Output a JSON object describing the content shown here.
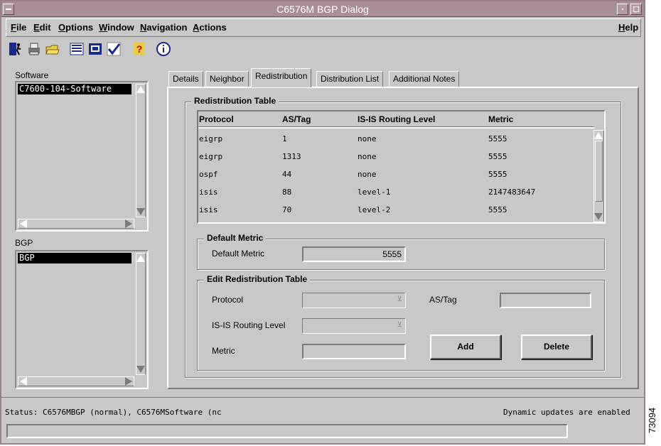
{
  "window": {
    "title": "C6576M BGP Dialog"
  },
  "menubar": {
    "items": [
      "File",
      "Edit",
      "Options",
      "Window",
      "Navigation",
      "Actions"
    ],
    "help": "Help"
  },
  "toolbar": {
    "icons": [
      "exit-icon",
      "printer-icon",
      "open-folder-icon",
      "list-icon",
      "properties-icon",
      "check-icon",
      "help-icon",
      "info-icon"
    ]
  },
  "left": {
    "software_label": "Software",
    "software_item": "C7600-104-Software",
    "bgp_label": "BGP",
    "bgp_item": "BGP"
  },
  "tabs": [
    "Details",
    "Neighbor",
    "Redistribution",
    "Distribution List",
    "Additional Notes"
  ],
  "active_tab": "Redistribution",
  "redistribution_table": {
    "title": "Redistribution Table",
    "columns": [
      "Protocol",
      "AS/Tag",
      "IS-IS Routing Level",
      "Metric"
    ],
    "rows": [
      [
        "eigrp",
        "1",
        "none",
        "5555"
      ],
      [
        "eigrp",
        "1313",
        "none",
        "5555"
      ],
      [
        "ospf",
        "44",
        "none",
        "5555"
      ],
      [
        "isis",
        "88",
        "level-1",
        "2147483647"
      ],
      [
        "isis",
        "70",
        "level-2",
        "5555"
      ]
    ]
  },
  "default_metric": {
    "title": "Default Metric",
    "label": "Default Metric",
    "value": "5555"
  },
  "edit_table": {
    "title": "Edit Redistribution Table",
    "protocol_label": "Protocol",
    "astag_label": "AS/Tag",
    "isis_label": "IS-IS Routing Level",
    "metric_label": "Metric",
    "add_label": "Add",
    "delete_label": "Delete"
  },
  "status": {
    "left": "Status: C6576MBGP (normal), C6576MSoftware (nc",
    "right": "Dynamic updates are enabled"
  },
  "figure_code": "73094"
}
